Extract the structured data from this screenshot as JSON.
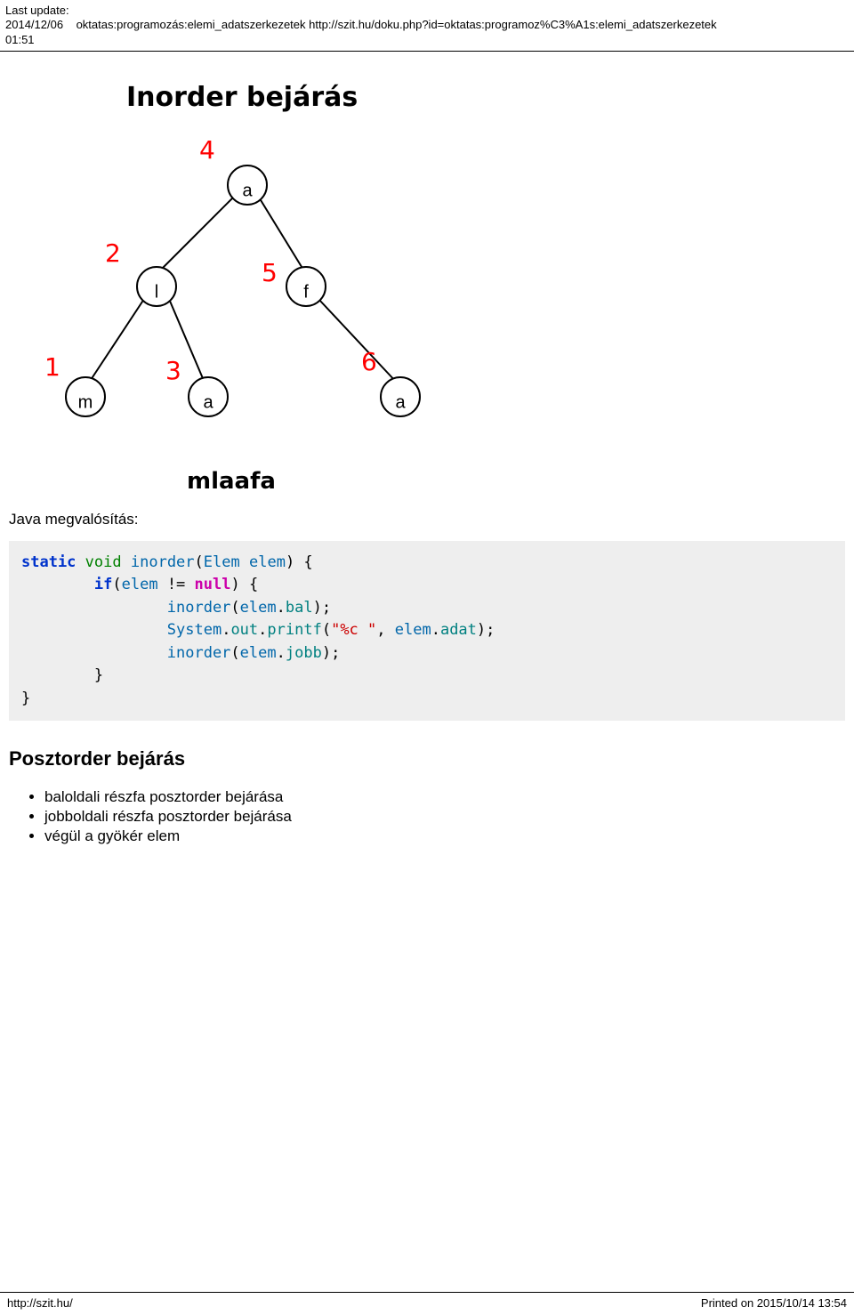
{
  "header": {
    "last_update_label": "Last update:",
    "last_update_date": "2014/12/06",
    "last_update_time": "01:51",
    "breadcrumb": "oktatas:programozás:elemi_adatszerkezetek http://szit.hu/doku.php?id=oktatas:programoz%C3%A1s:elemi_adatszerkezetek"
  },
  "diagram": {
    "title": "Inorder bejárás",
    "result": "mlaafa",
    "nodes": {
      "root": {
        "label": "a",
        "order": "4"
      },
      "l": {
        "label": "l",
        "order": "2"
      },
      "f": {
        "label": "f",
        "order": "5"
      },
      "m": {
        "label": "m",
        "order": "1"
      },
      "a2": {
        "label": "a",
        "order": "3"
      },
      "a3": {
        "label": "a",
        "order": "6"
      }
    }
  },
  "section_label": "Java megvalósítás:",
  "code": {
    "kw_static": "static",
    "kw_void": "void",
    "fn_inorder": "inorder",
    "type_elem": "Elem",
    "var_elem": "elem",
    "kw_if": "if",
    "kw_null": "null",
    "field_bal": "bal",
    "sys": "System",
    "out": "out",
    "printf": "printf",
    "fmt": "\"%c \"",
    "field_adat": "adat",
    "field_jobb": "jobb"
  },
  "posztorder": {
    "heading": "Posztorder bejárás",
    "items": [
      "baloldali részfa posztorder bejárása",
      "jobboldali részfa posztorder bejárása",
      "végül a gyökér elem"
    ]
  },
  "footer": {
    "left": "http://szit.hu/",
    "right": "Printed on 2015/10/14 13:54"
  }
}
